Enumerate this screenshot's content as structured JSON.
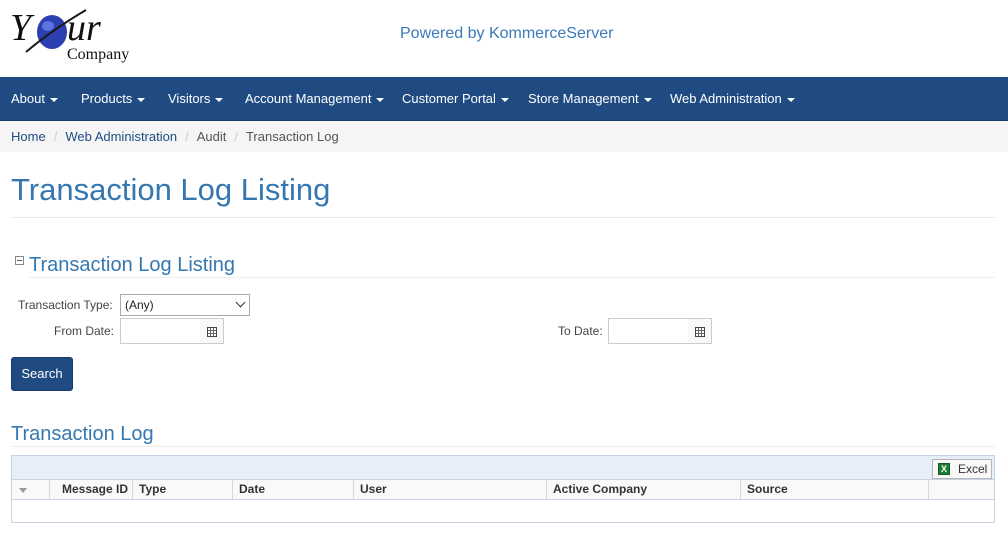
{
  "header": {
    "logo_your": "Your",
    "logo_company": "Company",
    "powered_by": "Powered by KommerceServer"
  },
  "navbar": {
    "items": [
      {
        "label": "About"
      },
      {
        "label": "Products"
      },
      {
        "label": "Visitors"
      },
      {
        "label": "Account Management"
      },
      {
        "label": "Customer Portal"
      },
      {
        "label": "Store Management"
      },
      {
        "label": "Web Administration"
      }
    ]
  },
  "breadcrumb": {
    "items": [
      "Home",
      "Web Administration",
      "Audit",
      "Transaction Log"
    ],
    "separator": "/"
  },
  "page": {
    "title": "Transaction Log Listing"
  },
  "filter": {
    "section_title": "Transaction Log Listing",
    "transaction_type_label": "Transaction Type:",
    "transaction_type_value": "(Any)",
    "from_date_label": "From Date:",
    "from_date_value": "",
    "to_date_label": "To Date:",
    "to_date_value": "",
    "search_label": "Search"
  },
  "log": {
    "title": "Transaction Log",
    "excel_label": "Excel",
    "columns": [
      "Message ID",
      "Type",
      "Date",
      "User",
      "Active Company",
      "Source"
    ],
    "rows": []
  },
  "colors": {
    "navbar_bg": "#1f4b82",
    "heading_blue": "#3577b0",
    "link_blue": "#1f4b82",
    "breadcrumb_bg": "#f5f5f5"
  }
}
